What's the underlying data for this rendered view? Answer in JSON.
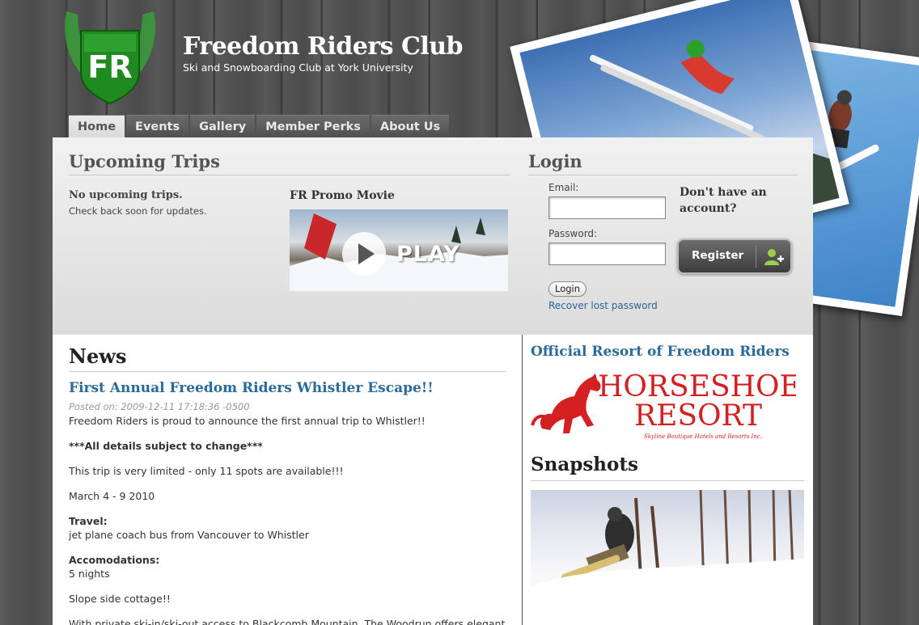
{
  "header": {
    "title": "Freedom Riders Club",
    "subtitle": "Ski and Snowboarding Club at York University",
    "logo_text": "FR"
  },
  "nav": {
    "tabs": [
      {
        "label": "Home",
        "active": true
      },
      {
        "label": "Events",
        "active": false
      },
      {
        "label": "Gallery",
        "active": false
      },
      {
        "label": "Member Perks",
        "active": false
      },
      {
        "label": "About Us",
        "active": false
      }
    ]
  },
  "trips": {
    "title": "Upcoming Trips",
    "empty_title": "No upcoming trips.",
    "empty_text": "Check back soon for updates."
  },
  "promo": {
    "title": "FR Promo Movie",
    "play_label": "PLAY"
  },
  "login": {
    "title": "Login",
    "email_label": "Email:",
    "email_value": "",
    "password_label": "Password:",
    "password_value": "",
    "button_label": "Login",
    "recover_label": "Recover lost password",
    "no_account": "Don't have an account?",
    "register_label": "Register"
  },
  "news": {
    "title": "News",
    "post": {
      "title": "First Annual Freedom Riders Whistler Escape!!",
      "meta": "Posted on: 2009-12-11 17:18:36 -0500",
      "intro": "Freedom Riders is proud to announce the first annual trip to Whistler!!",
      "notice": "***All details subject to change***",
      "limited": "This trip is very limited - only 11 spots are available!!!",
      "dates": "March 4 - 9 2010",
      "travel_label": "Travel:",
      "travel_text": "jet plane coach bus from Vancouver to Whistler",
      "accom_label": "Accomodations:",
      "accom_text": "5 nights",
      "slope": "Slope side cottage!!",
      "access": "With private ski-in/ski-out access to Blackcomb Mountain, The Woodrun offers elegant"
    }
  },
  "sidebar": {
    "resort_heading": "Official Resort of Freedom Riders",
    "resort_name_line1": "HORSESHOE",
    "resort_name_line2": "RESORT",
    "resort_tagline": "Skyline Boutique Hotels and Resorts Inc.",
    "snapshots_title": "Snapshots"
  },
  "colors": {
    "link_blue": "#2a6a9a",
    "resort_red": "#d42020",
    "logo_green": "#2a9a2a"
  }
}
